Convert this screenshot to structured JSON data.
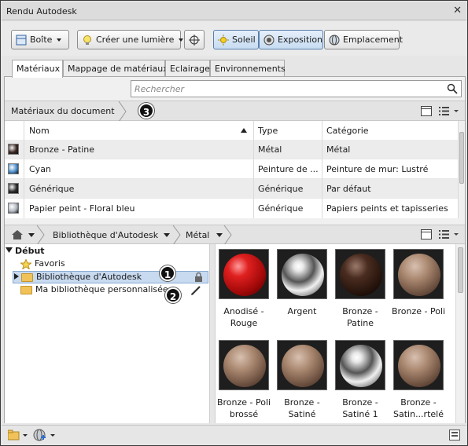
{
  "window": {
    "title": "Rendu Autodesk",
    "close_glyph": "✕"
  },
  "toolbar": {
    "box_label": "Boîte",
    "light_label": "Créer une lumière",
    "sun_label": "Soleil",
    "exposure_label": "Exposition",
    "location_label": "Emplacement"
  },
  "tabs": [
    "Matériaux",
    "Mappage de matériaux",
    "Eclairage",
    "Environnements"
  ],
  "search": {
    "placeholder": "Rechercher"
  },
  "document": {
    "breadcrumb": "Matériaux du document",
    "badge": "3",
    "columns": [
      "Nom",
      "Type",
      "Catégorie"
    ],
    "rows": [
      {
        "name": "Bronze - Patine",
        "type": "Métal",
        "category": "Métal",
        "thumb": "#3a2620"
      },
      {
        "name": "Cyan",
        "type": "Peinture de ...",
        "category": "Peinture de mur: Lustré",
        "thumb": "#4a8cc8"
      },
      {
        "name": "Générique",
        "type": "Générique",
        "category": "Par défaut",
        "thumb": "#2a2a2a"
      },
      {
        "name": "Papier peint - Floral bleu",
        "type": "Générique",
        "category": "Papiers peints et tapisseries",
        "thumb": "#b0b6c0"
      }
    ]
  },
  "library_nav": {
    "crumb1": "Bibliothèque d'Autodesk",
    "crumb2": "Métal"
  },
  "tree": {
    "root": "Début",
    "favorites": "Favoris",
    "autodesk_library": "Bibliothèque d'Autodesk",
    "my_library": "Ma bibliothèque personnalisée",
    "badge1": "1",
    "badge2": "2"
  },
  "swatches": [
    {
      "label": "Anodisé - Rouge",
      "color": "#d02020",
      "style": "red"
    },
    {
      "label": "Argent",
      "color": "#c8c8c8",
      "style": "chrome"
    },
    {
      "label": "Bronze - Patine",
      "color": "#3a2218",
      "style": "dark"
    },
    {
      "label": "Bronze - Poli",
      "color": "#8a6a58",
      "style": "bronze"
    },
    {
      "label": "Bronze - Poli brossé",
      "color": "#9a8070",
      "style": "bronze"
    },
    {
      "label": "Bronze - Satiné",
      "color": "#8a6a5a",
      "style": "bronze"
    },
    {
      "label": "Bronze - Satiné 1",
      "color": "#b8b8b8",
      "style": "chrome"
    },
    {
      "label": "Bronze - Satin...rtelé",
      "color": "#9a7868",
      "style": "bronze"
    }
  ]
}
